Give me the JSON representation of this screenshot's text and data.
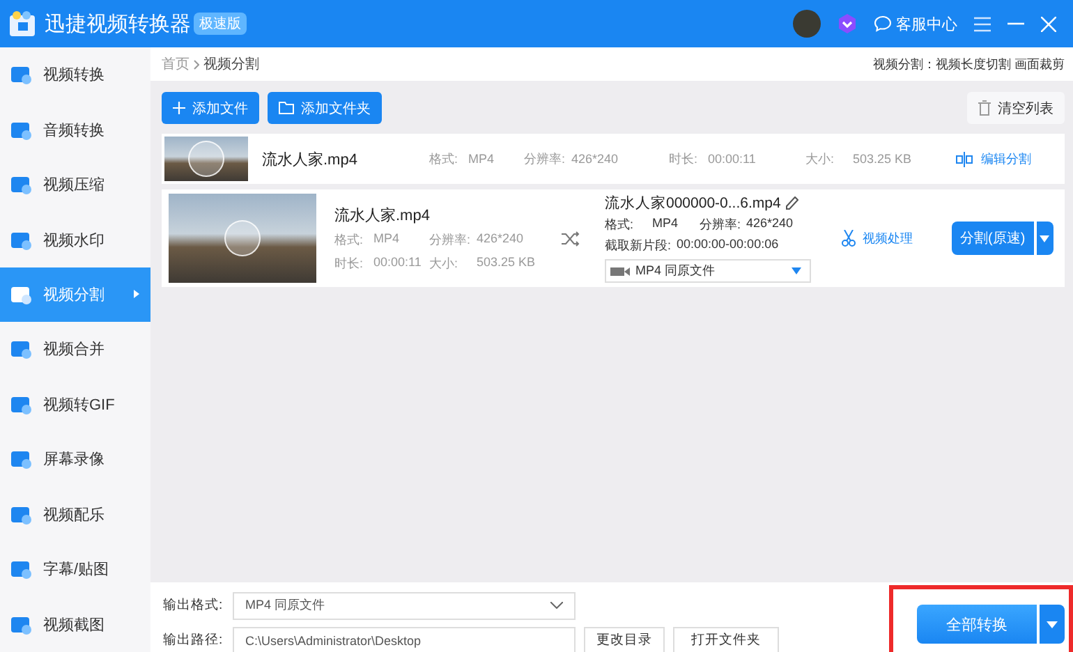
{
  "title_bar": {
    "app_name": "迅捷视频转换器",
    "edition_badge": "极速版",
    "support": "客服中心"
  },
  "sidebar": {
    "items": [
      {
        "label": "视频转换",
        "selected": false
      },
      {
        "label": "音频转换",
        "selected": false
      },
      {
        "label": "视频压缩",
        "selected": false
      },
      {
        "label": "视频水印",
        "selected": false
      },
      {
        "label": "视频分割",
        "selected": true
      },
      {
        "label": "视频合并",
        "selected": false
      },
      {
        "label": "视频转GIF",
        "selected": false
      },
      {
        "label": "屏幕录像",
        "selected": false
      },
      {
        "label": "视频配乐",
        "selected": false
      },
      {
        "label": "字幕/贴图",
        "selected": false
      },
      {
        "label": "视频截图",
        "selected": false
      }
    ]
  },
  "breadcrumb": [
    "首页",
    "视频分割"
  ],
  "hint": "视频分割：视频长度切割 画面裁剪",
  "toolbar": {
    "add_file": "添加文件",
    "add_folder": "添加文件夹",
    "clear": "清空列表"
  },
  "file_row": {
    "name": "流水人家.mp4",
    "format_label": "格式:",
    "format": "MP4",
    "resolution_label": "分辨率:",
    "resolution": "426*240",
    "duration_label": "时长:",
    "duration": "00:00:11",
    "size_label": "大小:",
    "size": "503.25 KB",
    "action": "编辑分割"
  },
  "split_row": {
    "source": {
      "name": "流水人家.mp4",
      "format_label": "格式:",
      "format": "MP4",
      "resolution_label": "分辨率:",
      "resolution": "426*240",
      "duration_label": "时长:",
      "duration": "00:00:11",
      "size_label": "大小:",
      "size": "503.25 KB"
    },
    "output": {
      "name": "流水人家000000-0...6.mp4",
      "format_label": "格式:",
      "format": "MP4",
      "resolution_label": "分辨率:",
      "resolution": "426*240",
      "segment_label": "截取新片段:",
      "segment": "00:00:00-00:00:06",
      "preset": "MP4  同原文件"
    },
    "process": "视频处理",
    "split_button": "分割(原速)"
  },
  "bottom": {
    "format_label": "输出格式:",
    "format": "MP4  同原文件",
    "path_label": "输出路径:",
    "path": "C:\\Users\\Administrator\\Desktop",
    "change_dir": "更改目录",
    "open_folder": "打开文件夹",
    "convert_all": "全部转换"
  }
}
